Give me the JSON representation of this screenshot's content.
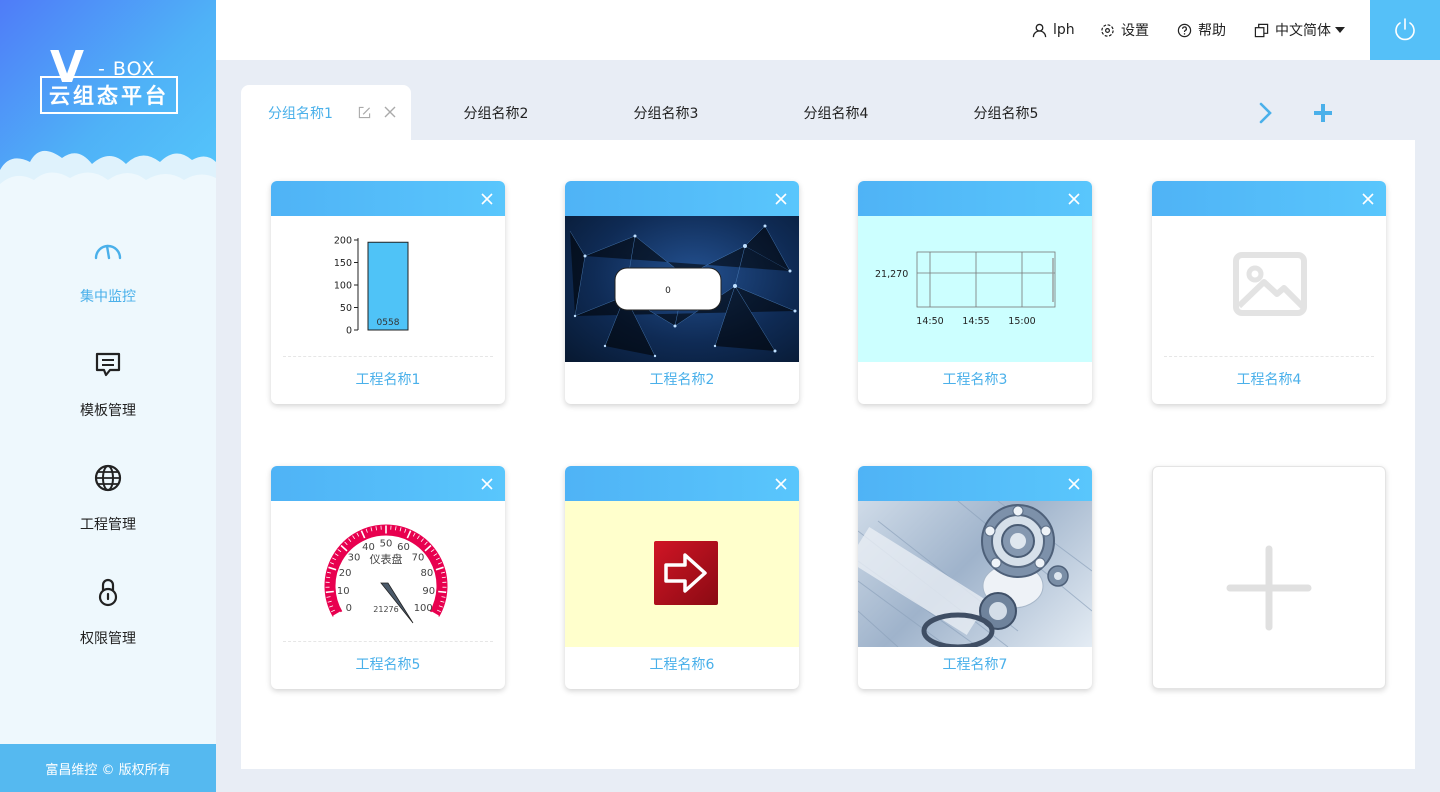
{
  "logo": {
    "v": "V",
    "box": "- BOX",
    "name": "云组态平台"
  },
  "nav": [
    {
      "label": "集中监控",
      "icon": "gauge-icon",
      "active": true
    },
    {
      "label": "模板管理",
      "icon": "message-icon",
      "active": false
    },
    {
      "label": "工程管理",
      "icon": "globe-icon",
      "active": false
    },
    {
      "label": "权限管理",
      "icon": "lock-icon",
      "active": false
    }
  ],
  "footer": "富昌维控 © 版权所有",
  "header": {
    "user": "lph",
    "settings": "设置",
    "help": "帮助",
    "language": "中文简体"
  },
  "tabs": [
    "分组名称1",
    "分组名称2",
    "分组名称3",
    "分组名称4",
    "分组名称5"
  ],
  "projects": [
    {
      "name": "工程名称1",
      "preview": "bar-chart"
    },
    {
      "name": "工程名称2",
      "preview": "network-display"
    },
    {
      "name": "工程名称3",
      "preview": "trend-chart"
    },
    {
      "name": "工程名称4",
      "preview": "image-placeholder"
    },
    {
      "name": "工程名称5",
      "preview": "gauge"
    },
    {
      "name": "工程名称6",
      "preview": "arrow-button"
    },
    {
      "name": "工程名称7",
      "preview": "bearing-photo"
    }
  ],
  "previews": {
    "bar": {
      "ticks": [
        "200",
        "150",
        "100",
        "50",
        "0"
      ],
      "label": "0558",
      "value": 195,
      "max": 200
    },
    "display": {
      "value": "0"
    },
    "trend": {
      "ylabel": "21,270",
      "xlabels": [
        "14:50",
        "14:55",
        "15:00"
      ]
    },
    "gauge": {
      "title": "仪表盘",
      "value": "21276",
      "ticks": [
        "0",
        "10",
        "20",
        "30",
        "40",
        "50",
        "60",
        "70",
        "80",
        "90",
        "100"
      ]
    }
  },
  "colors": {
    "accent": "#4ab0ea",
    "header_gradient_start": "#4fb3f6",
    "header_gradient_end": "#59c6fc",
    "gauge": "#e8004f"
  }
}
